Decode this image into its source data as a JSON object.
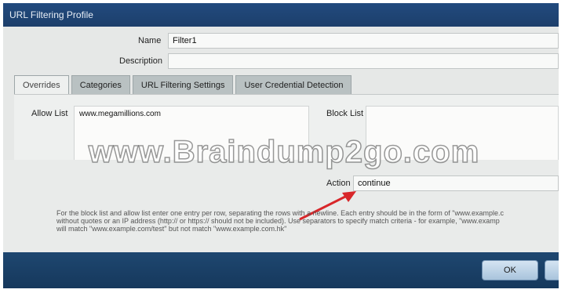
{
  "window": {
    "title": "URL Filtering Profile"
  },
  "form": {
    "name_label": "Name",
    "name_value": "Filter1",
    "description_label": "Description",
    "description_value": ""
  },
  "tabs": [
    {
      "label": "Overrides",
      "active": true
    },
    {
      "label": "Categories",
      "active": false
    },
    {
      "label": "URL Filtering Settings",
      "active": false
    },
    {
      "label": "User Credential Detection",
      "active": false
    }
  ],
  "overrides": {
    "allow_list_label": "Allow List",
    "allow_list_entries": [
      "www.megamillions.com"
    ],
    "block_list_label": "Block List",
    "block_list_entries": [],
    "action_label": "Action",
    "action_value": "continue",
    "help_lines": [
      "For the block list and allow list enter one entry per row, separating the rows with a newline. Each entry should be in the form of \"www.example.c",
      "without quotes or an IP address (http:// or https:// should not be included). Use separators to specify match criteria - for example, \"www.examp",
      "will match \"www.example.com/test\" but not match \"www.example.com.hk\""
    ]
  },
  "footer": {
    "ok_label": "OK",
    "cancel_label": ""
  },
  "watermark": "www.Braindump2go.com",
  "colors": {
    "titlebar": "#1d3f6b",
    "arrow": "#d8262a",
    "button": "#bcd3e8"
  }
}
